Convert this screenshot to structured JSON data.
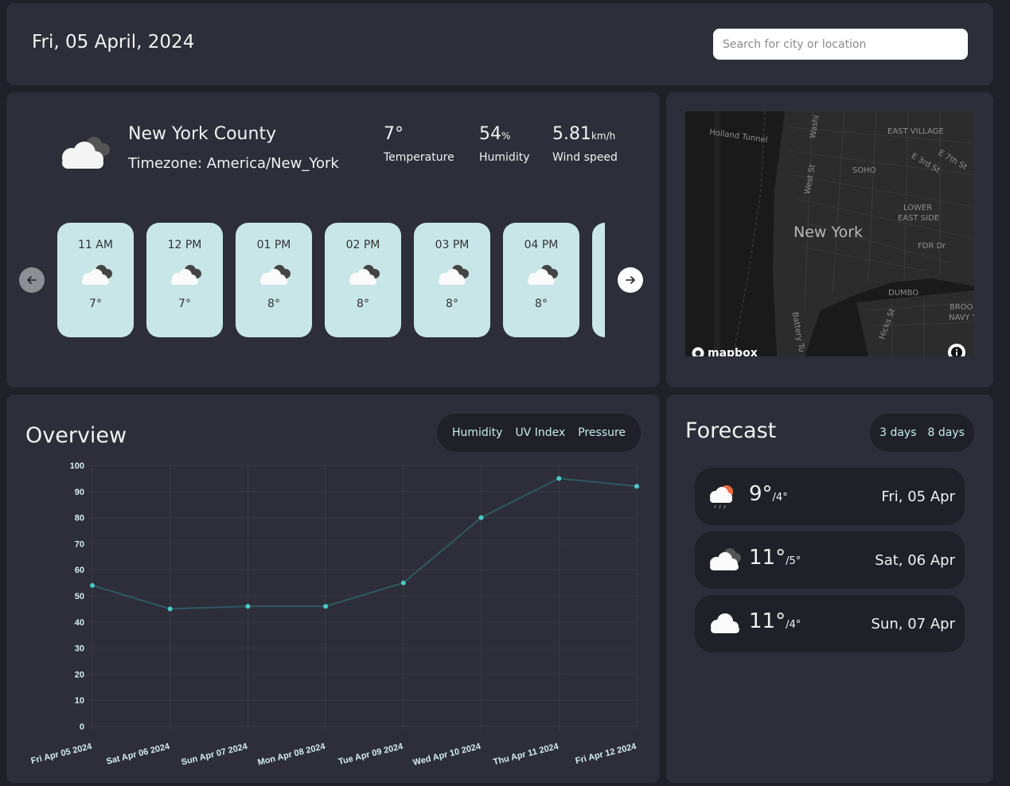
{
  "header": {
    "date": "Fri, 05 April, 2024",
    "search_placeholder": "Search for city or location"
  },
  "current": {
    "location": "New York County",
    "timezone": "Timezone: America/New_York",
    "temperature": "7°",
    "temperature_label": "Temperature",
    "humidity": "54",
    "humidity_unit": "%",
    "humidity_label": "Humidity",
    "wind": "5.81",
    "wind_unit": "km/h",
    "wind_label": "Wind speed",
    "icon": "cloudy-icon"
  },
  "hourly": [
    {
      "time": "11 AM",
      "temp": "7°",
      "icon": "cloudy-icon"
    },
    {
      "time": "12 PM",
      "temp": "7°",
      "icon": "cloudy-icon"
    },
    {
      "time": "01 PM",
      "temp": "8°",
      "icon": "cloudy-icon"
    },
    {
      "time": "02 PM",
      "temp": "8°",
      "icon": "cloudy-icon"
    },
    {
      "time": "03 PM",
      "temp": "8°",
      "icon": "cloudy-icon"
    },
    {
      "time": "04 PM",
      "temp": "8°",
      "icon": "cloudy-icon"
    },
    {
      "time": "",
      "temp": "",
      "icon": ""
    }
  ],
  "map": {
    "city": "New York",
    "labels": [
      {
        "text": "Holland Tunnel"
      },
      {
        "text": "EAST VILLAGE"
      },
      {
        "text": "SOHO"
      },
      {
        "text": "LOWER"
      },
      {
        "text": "EAST SIDE"
      },
      {
        "text": "FDR Dr"
      },
      {
        "text": "DUMBO"
      },
      {
        "text": "BROO"
      },
      {
        "text": "NAVY Y"
      },
      {
        "text": "West St"
      },
      {
        "text": "Washi"
      },
      {
        "text": "E 3rd St"
      },
      {
        "text": "E 7th St"
      },
      {
        "text": "Battery Tu"
      },
      {
        "text": "Hicks St"
      }
    ],
    "attribution": "mapbox"
  },
  "overview": {
    "title": "Overview",
    "tabs": [
      "Humidity",
      "UV Index",
      "Pressure"
    ]
  },
  "chart_data": {
    "type": "line",
    "categories": [
      "Fri Apr 05 2024",
      "Sat Apr 06 2024",
      "Sun Apr 07 2024",
      "Mon Apr 08 2024",
      "Tue Apr 09 2024",
      "Wed Apr 10 2024",
      "Thu Apr 11 2024",
      "Fri Apr 12 2024"
    ],
    "values": [
      54,
      45,
      46,
      46,
      55,
      80,
      95,
      92
    ],
    "ylim": [
      0,
      100
    ],
    "yticks": [
      0,
      10,
      20,
      30,
      40,
      50,
      60,
      70,
      80,
      90,
      100
    ],
    "grid": true,
    "line_color": "#2f5a60",
    "point_color": "#48c9c9"
  },
  "forecast": {
    "title": "Forecast",
    "tabs": [
      "3 days",
      "8 days"
    ],
    "days": [
      {
        "high": "9°",
        "low": "/4°",
        "date": "Fri, 05 Apr",
        "icon": "rain-sun-icon"
      },
      {
        "high": "11°",
        "low": "/5°",
        "date": "Sat, 06 Apr",
        "icon": "cloudy-icon"
      },
      {
        "high": "11°",
        "low": "/4°",
        "date": "Sun, 07 Apr",
        "icon": "cloud-icon"
      }
    ]
  },
  "colors": {
    "background": "#1f2028",
    "panel": "#2d2e39",
    "hour_card": "#c8e6e8",
    "accent": "#48c9c9"
  }
}
